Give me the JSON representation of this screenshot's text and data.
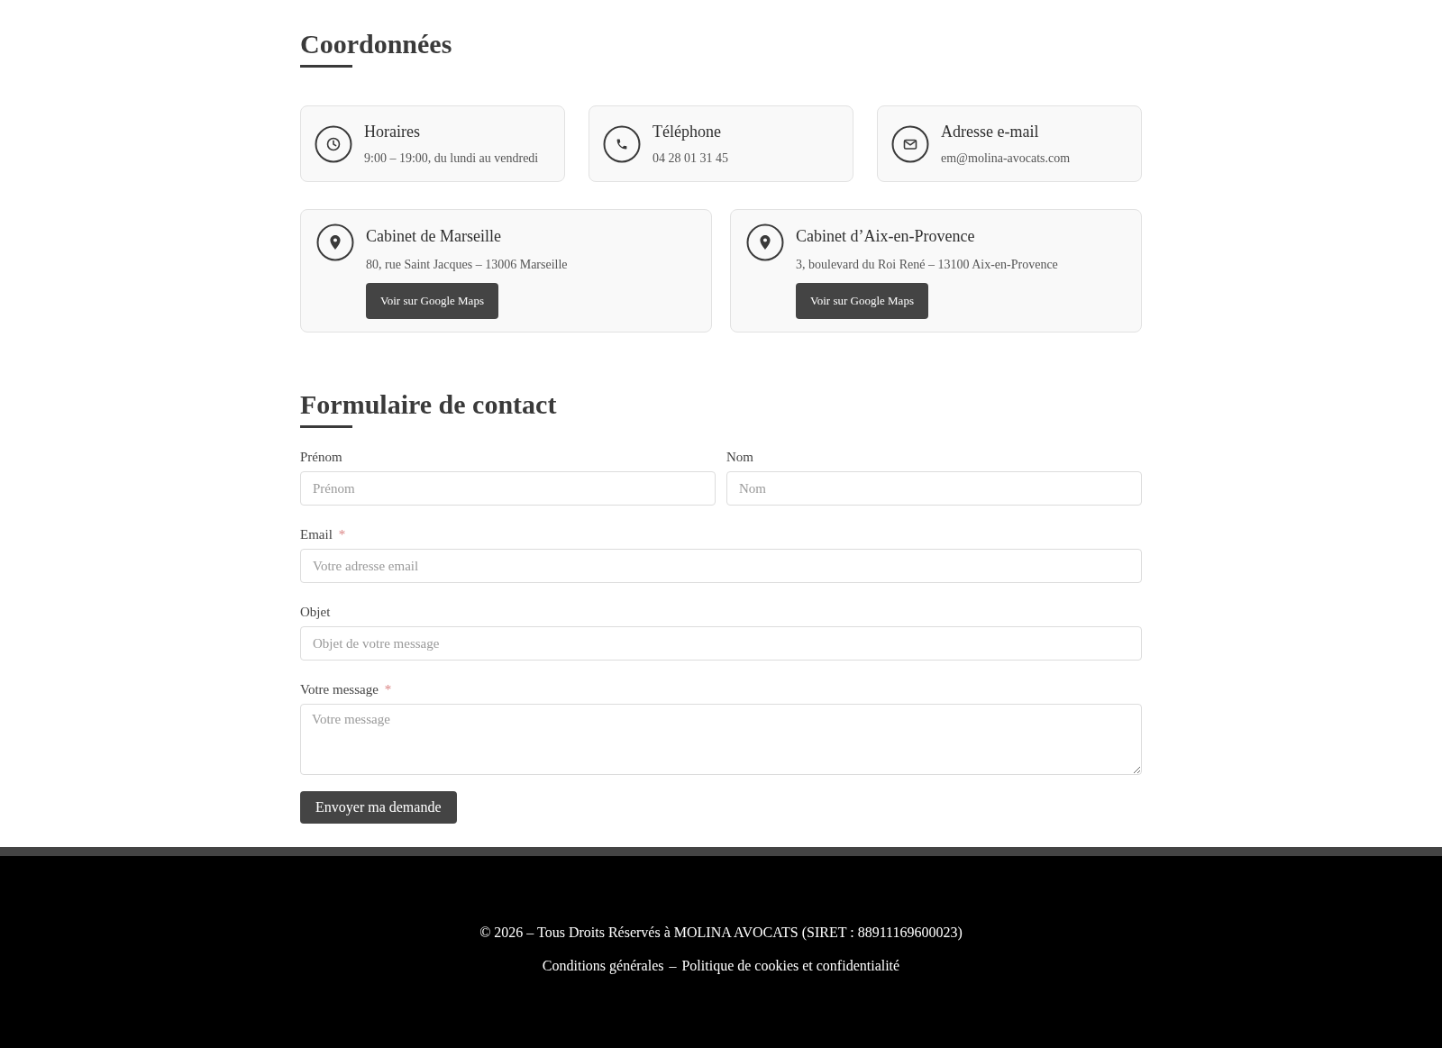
{
  "contact_section": {
    "title": "Coordonnées",
    "info_cards": [
      {
        "kind": "hours",
        "title": "Horaires",
        "text": "9:00 – 19:00, du lundi au vendredi"
      },
      {
        "kind": "phone",
        "title": "Téléphone",
        "text": "04 28 01 31 45"
      },
      {
        "kind": "email",
        "title": "Adresse e-mail",
        "text": "em@molina-avocats.com"
      }
    ],
    "offices": [
      {
        "title": "Cabinet de Marseille",
        "address": "80, rue Saint Jacques – 13006 Marseille",
        "button": "Voir sur Google Maps"
      },
      {
        "title": "Cabinet d’Aix-en-Provence",
        "address": "3, boulevard du Roi René – 13100 Aix-en-Provence",
        "button": "Voir sur Google Maps"
      }
    ]
  },
  "contact_form": {
    "title": "Formulaire de contact",
    "rows": [
      {
        "fields": [
          {
            "kind": "input",
            "label": "Prénom",
            "placeholder": "Prénom"
          },
          {
            "kind": "input",
            "label": "Nom",
            "placeholder": "Nom"
          }
        ]
      },
      {
        "fields": [
          {
            "kind": "input",
            "label": "Email",
            "required_mark": "*",
            "placeholder": "Votre adresse email"
          }
        ]
      },
      {
        "fields": [
          {
            "kind": "input",
            "label": "Objet",
            "placeholder": "Objet de votre message"
          }
        ]
      },
      {
        "fields": [
          {
            "kind": "textarea",
            "label": "Votre message",
            "required_mark": "*",
            "placeholder": "Votre message"
          }
        ]
      }
    ],
    "submit_button": "Envoyer ma demande"
  },
  "footer": {
    "copyright": "© 2026 – Tous Droits Réservés à MOLINA AVOCATS (SIRET : 88911169600023)",
    "links": [
      {
        "label": "Conditions générales"
      },
      {
        "label": "Politique de cookies et confidentialité"
      }
    ],
    "separator": "–"
  }
}
